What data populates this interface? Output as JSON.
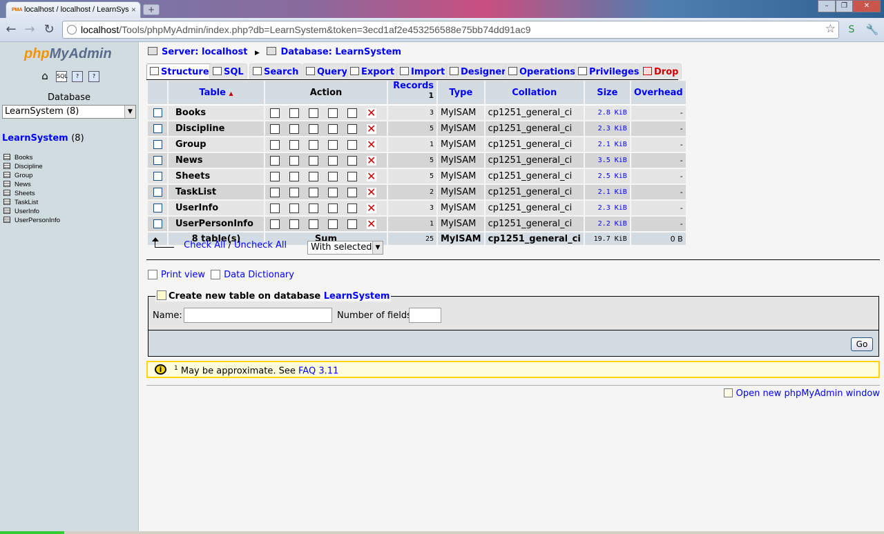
{
  "browser": {
    "tab_title": "localhost / localhost / LearnSys",
    "tab_favicon": "PMA",
    "tab_close": "×",
    "new_tab": "+",
    "url_host": "localhost",
    "url_rest": "/Tools/phpMyAdmin/index.php?db=LearnSystem&token=3ecd1af2e453256588e75bb74dd91ac9",
    "back": "←",
    "forward": "→",
    "reload": "↻",
    "star": "☆",
    "min": "–",
    "max": "❐",
    "close": "✕"
  },
  "left": {
    "logo_php": "php",
    "logo_myadmin": "MyAdmin",
    "database_label": "Database",
    "db_select_value": "LearnSystem (8)",
    "db_link": "LearnSystem",
    "db_count": "(8)",
    "tables": [
      "Books",
      "Discipline",
      "Group",
      "News",
      "Sheets",
      "TaskList",
      "UserInfo",
      "UserPersonInfo"
    ]
  },
  "breadcrumb": {
    "server": "Server: localhost",
    "database": "Database: LearnSystem"
  },
  "tabs": {
    "structure": "Structure",
    "sql": "SQL",
    "search": "Search",
    "query": "Query",
    "export": "Export",
    "import": "Import",
    "designer": "Designer",
    "operations": "Operations",
    "privileges": "Privileges",
    "drop": "Drop"
  },
  "table_headers": {
    "table": "Table",
    "sort_arrow": "▲",
    "action": "Action",
    "records": "Records",
    "records_sup": "1",
    "type": "Type",
    "collation": "Collation",
    "size": "Size",
    "overhead": "Overhead"
  },
  "rows": [
    {
      "name": "Books",
      "records": "3",
      "type": "MyISAM",
      "collation": "cp1251_general_ci",
      "size": "2.8 KiB",
      "overhead": "-"
    },
    {
      "name": "Discipline",
      "records": "5",
      "type": "MyISAM",
      "collation": "cp1251_general_ci",
      "size": "2.3 KiB",
      "overhead": "-"
    },
    {
      "name": "Group",
      "records": "1",
      "type": "MyISAM",
      "collation": "cp1251_general_ci",
      "size": "2.1 KiB",
      "overhead": "-"
    },
    {
      "name": "News",
      "records": "5",
      "type": "MyISAM",
      "collation": "cp1251_general_ci",
      "size": "3.5 KiB",
      "overhead": "-"
    },
    {
      "name": "Sheets",
      "records": "5",
      "type": "MyISAM",
      "collation": "cp1251_general_ci",
      "size": "2.5 KiB",
      "overhead": "-"
    },
    {
      "name": "TaskList",
      "records": "2",
      "type": "MyISAM",
      "collation": "cp1251_general_ci",
      "size": "2.1 KiB",
      "overhead": "-"
    },
    {
      "name": "UserInfo",
      "records": "3",
      "type": "MyISAM",
      "collation": "cp1251_general_ci",
      "size": "2.3 KiB",
      "overhead": "-"
    },
    {
      "name": "UserPersonInfo",
      "records": "1",
      "type": "MyISAM",
      "collation": "cp1251_general_ci",
      "size": "2.2 KiB",
      "overhead": "-"
    }
  ],
  "summary": {
    "tables": "8 table(s)",
    "sum": "Sum",
    "records": "25",
    "type": "MyISAM",
    "collation": "cp1251_general_ci",
    "size": "19.7 KiB",
    "overhead": "0 B"
  },
  "bulk": {
    "check_all": "Check All",
    "slash": " / ",
    "uncheck_all": "Uncheck All",
    "with_selected": "With selected:"
  },
  "links": {
    "print_view": "Print view",
    "data_dictionary": "Data Dictionary"
  },
  "create": {
    "legend_text": "Create new table on database ",
    "legend_db": "LearnSystem",
    "name_label": "Name:",
    "fields_label": "Number of fields:",
    "go": "Go"
  },
  "notice": {
    "icon": "i",
    "sup": "1",
    "text": " May be approximate. See ",
    "faq": "FAQ 3.11"
  },
  "footer": {
    "open_new_window": "Open new phpMyAdmin window"
  },
  "colors": {
    "link": "#0000ff",
    "left_bg": "#d0dce0",
    "header_bg": "#d3dce3",
    "drop": "#cc0000",
    "notice_border": "#ffd700"
  }
}
